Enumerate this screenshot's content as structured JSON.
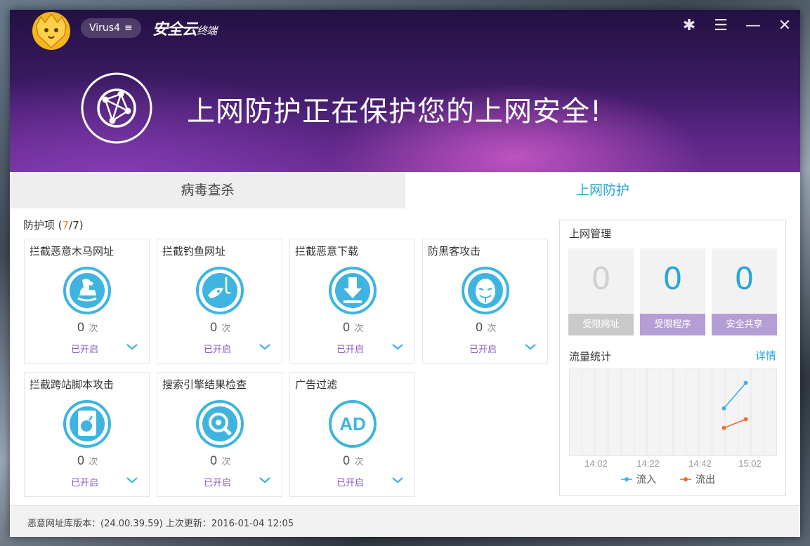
{
  "header": {
    "user_label": "Virus4",
    "menu_glyph": "≡",
    "app_name": "安全云",
    "app_suffix": "终端",
    "settings_glyph": "✱",
    "list_glyph": "☰",
    "minimize_glyph": "—",
    "close_glyph": "✕"
  },
  "banner": {
    "headline": "上网防护正在保护您的上网安全!"
  },
  "tabs": [
    {
      "label": "病毒查杀"
    },
    {
      "label": "上网防护"
    }
  ],
  "protection": {
    "title_prefix": "防护项 (",
    "enabled": "7",
    "separator": "/",
    "total": "7",
    "title_suffix": ")",
    "count_unit": "次",
    "items": [
      {
        "name": "拦截恶意木马网址",
        "icon": "trojan-horse-icon",
        "count": "0",
        "status": "已开启"
      },
      {
        "name": "拦截钓鱼网址",
        "icon": "phishing-hook-icon",
        "count": "0",
        "status": "已开启"
      },
      {
        "name": "拦截恶意下载",
        "icon": "download-block-icon",
        "count": "0",
        "status": "已开启"
      },
      {
        "name": "防黑客攻击",
        "icon": "hacker-mask-icon",
        "count": "0",
        "status": "已开启"
      },
      {
        "name": "拦截跨站脚本攻击",
        "icon": "script-bomb-icon",
        "count": "0",
        "status": "已开启"
      },
      {
        "name": "搜索引擎结果检查",
        "icon": "search-target-icon",
        "count": "0",
        "status": "已开启"
      },
      {
        "name": "广告过滤",
        "icon": "ad-filter-icon",
        "text": "AD",
        "count": "0",
        "status": "已开启"
      }
    ]
  },
  "web_management": {
    "title": "上网管理",
    "stats": [
      {
        "value": "0",
        "label": "受限网址"
      },
      {
        "value": "0",
        "label": "受限程序"
      },
      {
        "value": "0",
        "label": "安全共享"
      }
    ],
    "flow_title": "流量统计",
    "detail_link": "详情"
  },
  "chart_data": {
    "type": "line",
    "x": [
      "14:02",
      "14:22",
      "14:42",
      "15:02"
    ],
    "series": [
      {
        "name": "流入",
        "color": "#3fb4e0",
        "points": [
          [
            0.745,
            0.65
          ],
          [
            0.85,
            1.0
          ]
        ]
      },
      {
        "name": "流出",
        "color": "#f26b35",
        "points": [
          [
            0.745,
            0.38
          ],
          [
            0.85,
            0.5
          ]
        ]
      }
    ],
    "ylim": [
      0,
      1.2
    ],
    "grid": true,
    "legend": "bottom"
  },
  "footer": {
    "text": "恶意网址库版本：(24.00.39.59)  上次更新：2016-01-04 12:05"
  },
  "colors": {
    "accent": "#29a6d6",
    "status": "#8b5cc4",
    "count_highlight": "#f08a2c"
  }
}
